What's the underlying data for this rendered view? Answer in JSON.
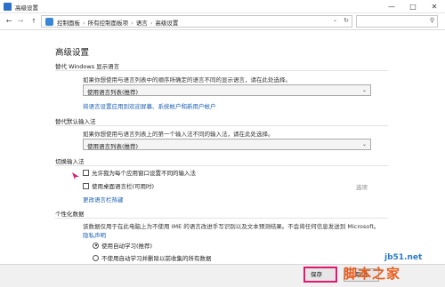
{
  "window": {
    "title": "高级设置"
  },
  "nav": {
    "breadcrumbs": [
      "控制面板",
      "所有控制面板项",
      "语言",
      "高级设置"
    ]
  },
  "page": {
    "heading": "高级设置",
    "sections": {
      "display_lang": {
        "title": "替代 Windows 显示语言",
        "desc": "如果你想使用与语言列表中的顺序所确定的语言不同的显示语言，请在此处选择。",
        "select_value": "使用语言列表(推荐)",
        "link": "将语言设置应用到欢迎屏幕、系统帐户和新用户帐户"
      },
      "input_method": {
        "title": "替代默认输入法",
        "desc": "如果你想使用与语言列表上的第一个输入法不同的输入法，请在此处选择。",
        "select_value": "使用语言列表(推荐)"
      },
      "switch_input": {
        "title": "切换输入法",
        "cb1": "允许我为每个应用窗口设置不同的输入法",
        "cb2": "使用桌面语言栏(可用时)",
        "options_link": "选项",
        "hotkey_link": "更改语言栏热键"
      },
      "personalization": {
        "title": "个性化数据",
        "desc": "该数据仅用于在此电脑上为不使用 IME 的语言改进手写识别以及文本预测结果。不会将任何信息发送到 Microsoft。",
        "privacy_link": "隐私声明",
        "radio1": "使用自动学习(推荐)",
        "radio2": "不使用自动学习并删除以前收集的所有数据"
      }
    }
  },
  "footer": {
    "save_label": "保存",
    "cancel_label": "取消"
  },
  "watermark": {
    "site": "jb51.net",
    "brand": "脚本之家"
  },
  "colors": {
    "link": "#1a5fb4",
    "highlight": "#e1186f"
  }
}
